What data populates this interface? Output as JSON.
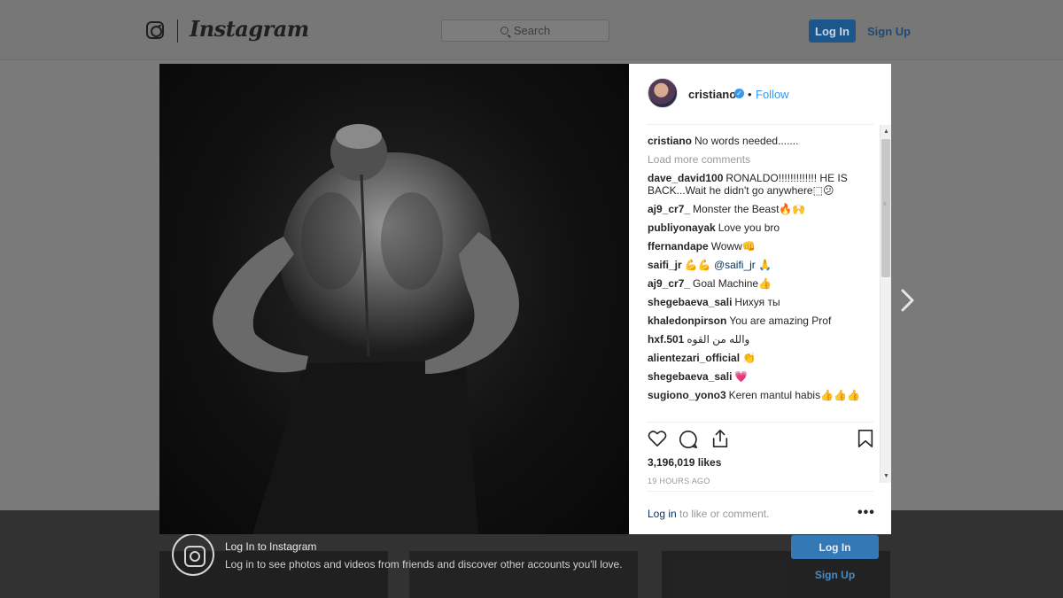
{
  "header": {
    "logo_text": "Instagram",
    "search_placeholder": "Search",
    "login_label": "Log In",
    "signup_label": "Sign Up"
  },
  "post": {
    "author": "cristiano",
    "follow_label": "Follow",
    "dot": "•",
    "caption": {
      "user": "cristiano",
      "text": "No words needed......."
    },
    "load_more": "Load more comments",
    "comments": [
      {
        "user": "dave_david100",
        "text": "RONALDO!!!!!!!!!!!!! HE IS BACK...Wait he didn't go anywhere⬚😕"
      },
      {
        "user": "aj9_cr7_",
        "text": "Monster the Beast🔥🙌"
      },
      {
        "user": "publiyonayak",
        "text": "Love you bro"
      },
      {
        "user": "ffernandape",
        "text": "Woww👊"
      },
      {
        "user": "saifi_jr",
        "text": "💪💪",
        "mention": "@saifi_jr",
        "after": "🙏"
      },
      {
        "user": "aj9_cr7_",
        "text": "Goal Machine👍"
      },
      {
        "user": "shegebaeva_sali",
        "text": "Нихуя ты"
      },
      {
        "user": "khaledonpirson",
        "text": "You are amazing Prof"
      },
      {
        "user": "hxf.501",
        "text": "والله من القوه"
      },
      {
        "user": "alientezari_official",
        "text": "👏"
      },
      {
        "user": "shegebaeva_sali",
        "text": "💗"
      },
      {
        "user": "sugiono_yono3",
        "text": "Keren mantul habis👍👍👍"
      }
    ],
    "likes": "3,196,019 likes",
    "time_ago": "19 HOURS AGO",
    "login_link": "Log in",
    "login_rest": " to like or comment.",
    "more_dots": "•••"
  },
  "banner": {
    "title": "Log In to Instagram",
    "subtitle": "Log in to see photos and videos from friends and discover other accounts you'll love.",
    "login_label": "Log In",
    "signup_label": "Sign Up"
  },
  "icons": {
    "brand": "instagram-glyph-icon",
    "search": "search-icon",
    "verified": "verified-badge-icon",
    "like": "heart-icon",
    "comment": "comment-bubble-icon",
    "share": "share-icon",
    "save": "bookmark-icon",
    "next": "chevron-right-icon"
  },
  "colors": {
    "accent": "#3897f0",
    "button_dim": "#1d568a"
  }
}
